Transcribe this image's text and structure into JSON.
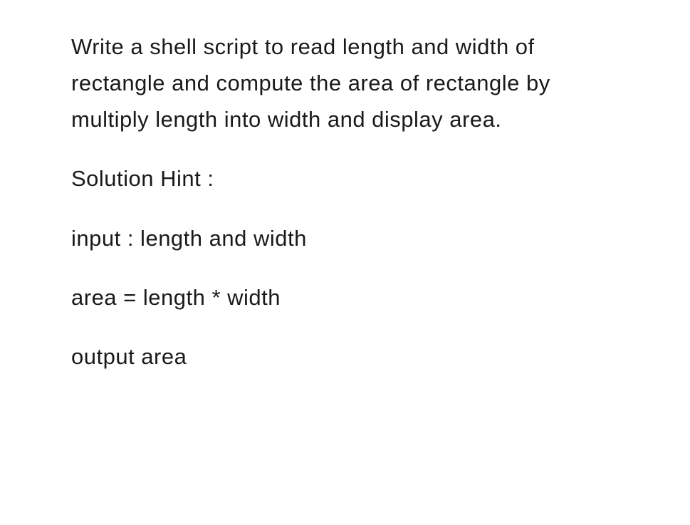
{
  "question": "Write a shell script to read length and width of rectangle and compute the area of rectangle by multiply length into width and display area.",
  "hint_title": "Solution Hint :",
  "hint_lines": {
    "input": "input : length and width",
    "formula": "area = length * width",
    "output": "output area"
  }
}
